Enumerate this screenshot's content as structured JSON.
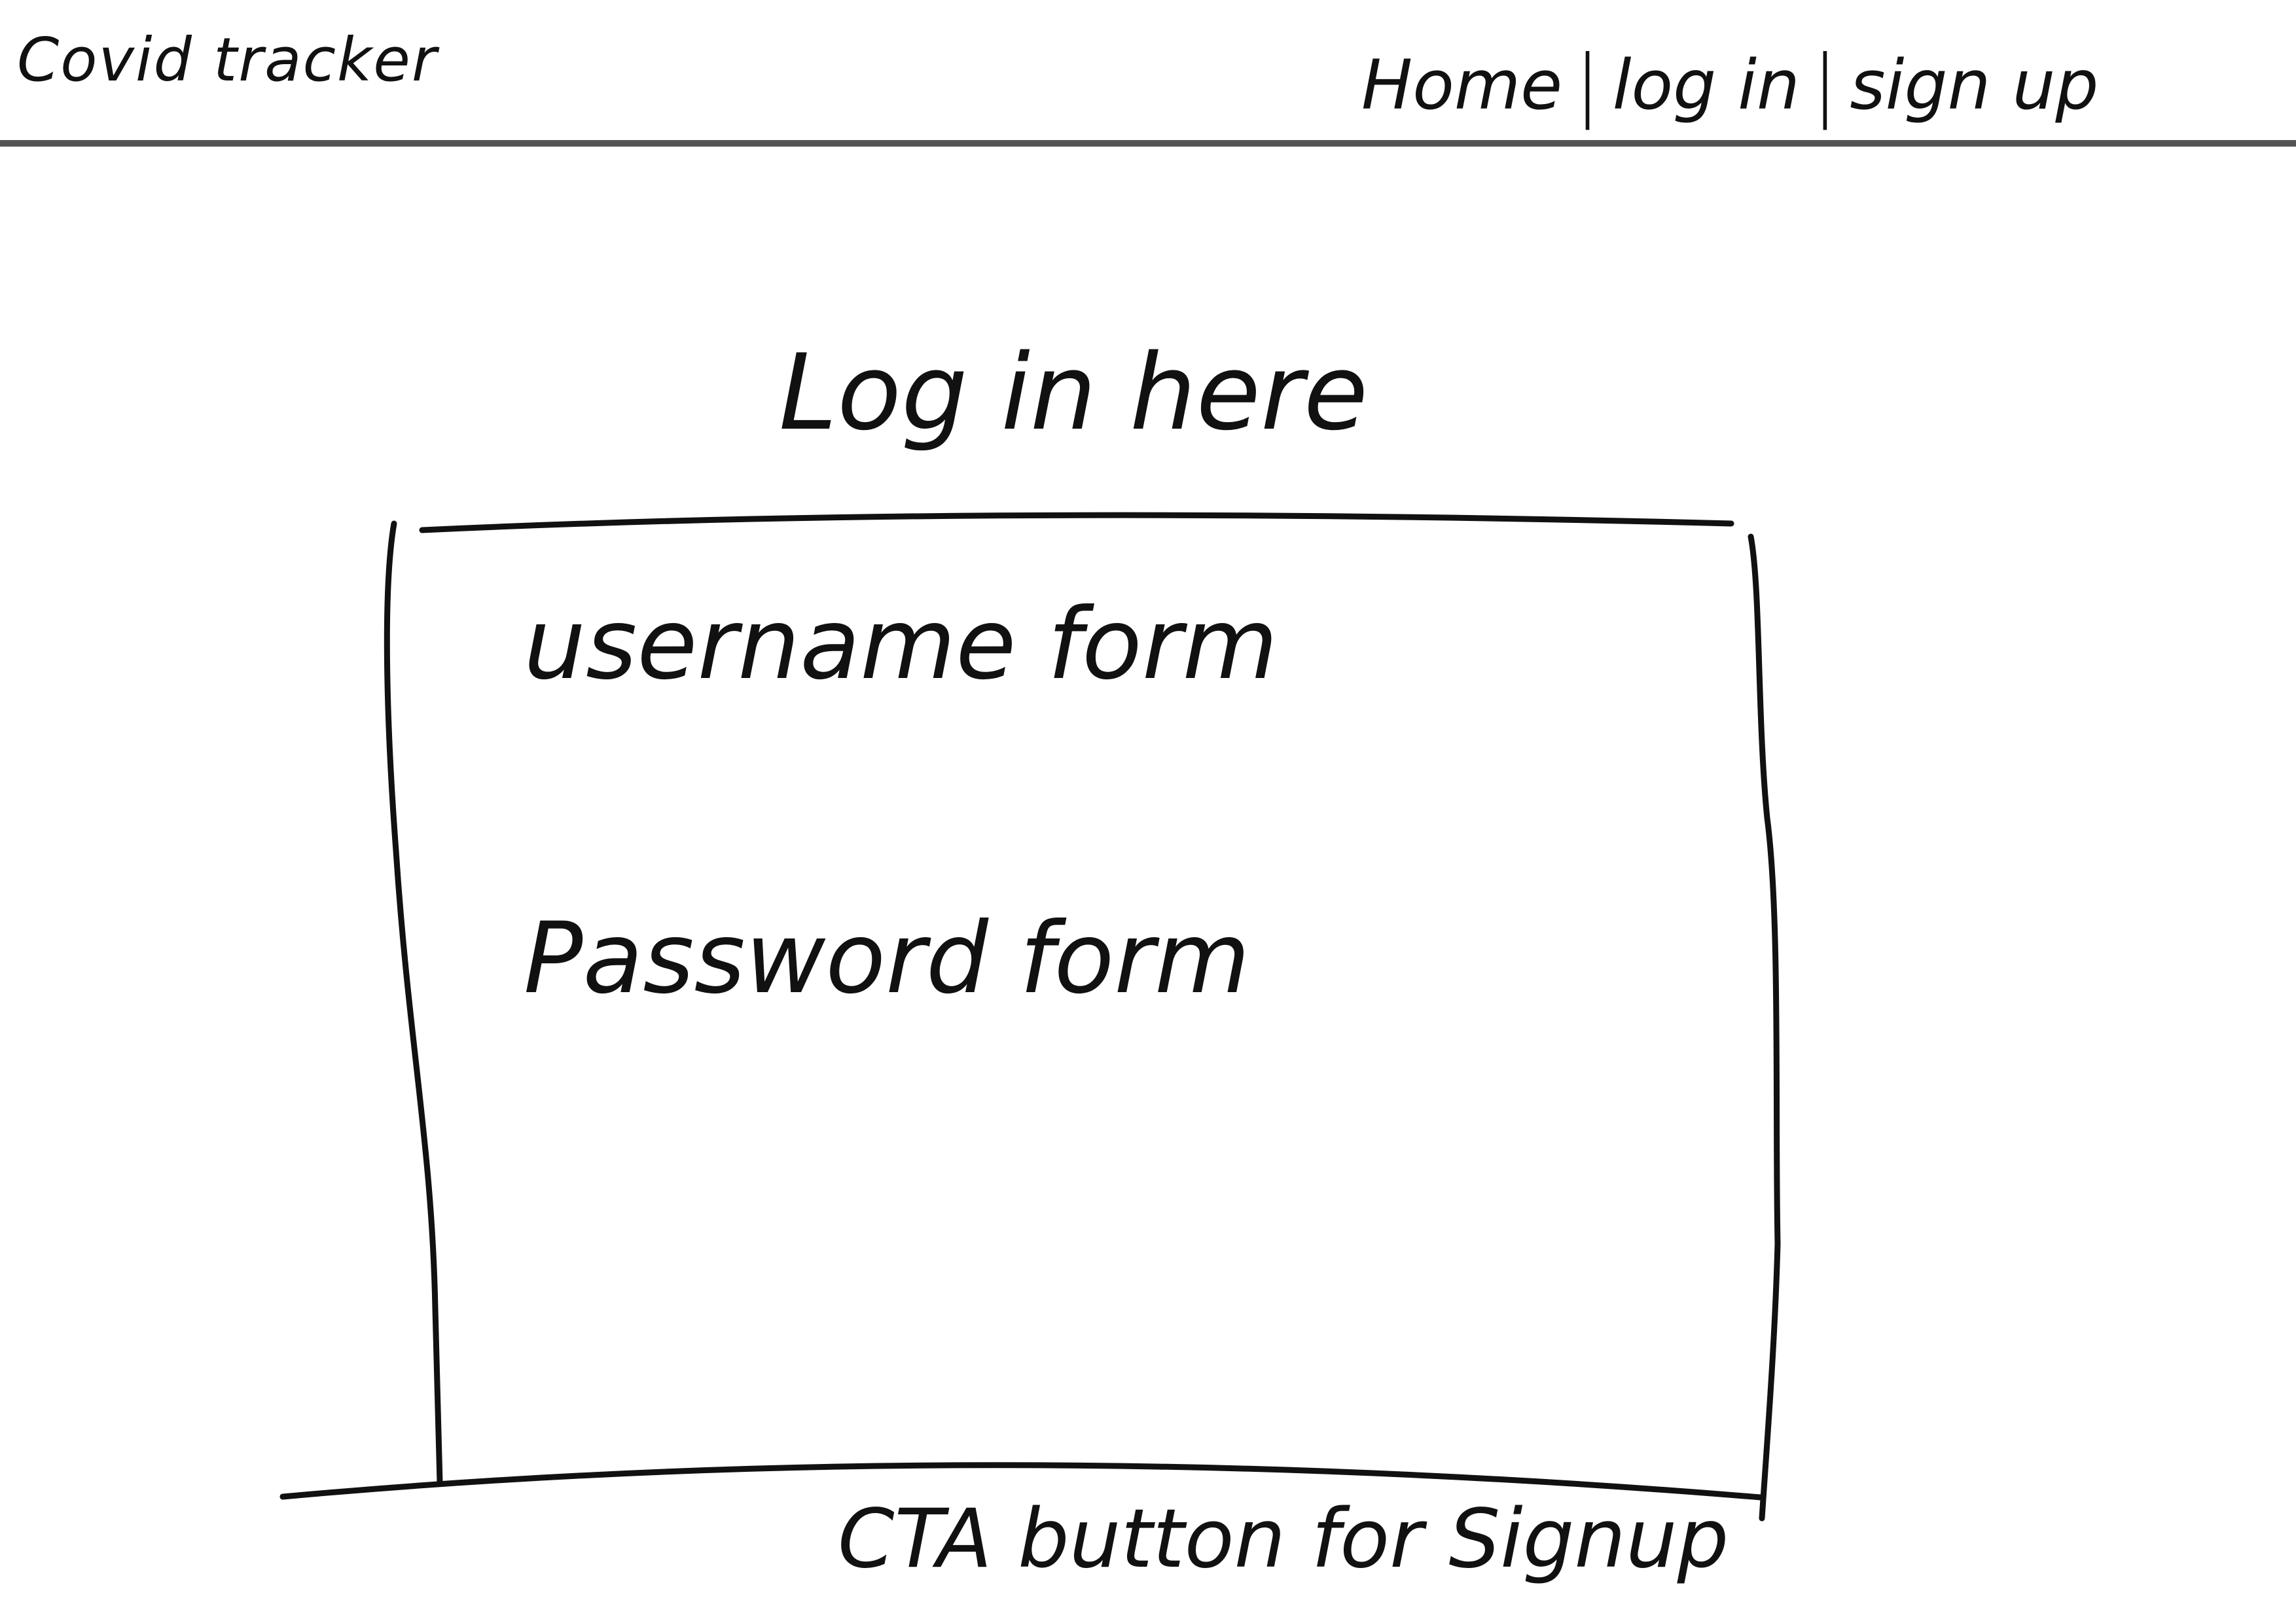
{
  "header": {
    "brand": "Covid tracker",
    "nav": [
      {
        "label": "Home"
      },
      {
        "label": "log in"
      },
      {
        "label": "sign up"
      }
    ],
    "separator": "|"
  },
  "main": {
    "title": "Log in here",
    "form": {
      "username_label": "username form",
      "password_label": "Password form"
    },
    "cta": "CTA button for Signup"
  },
  "colors": {
    "ink": "#111111",
    "header_rule": "#555555",
    "background": "#ffffff"
  }
}
